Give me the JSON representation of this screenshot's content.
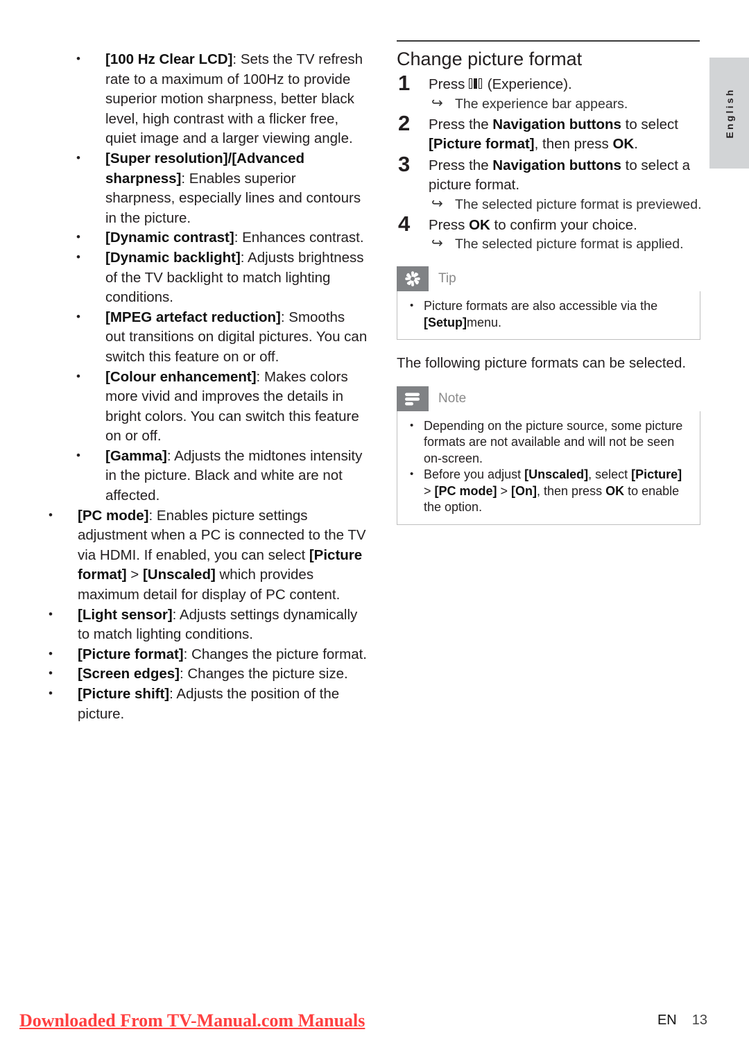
{
  "left_column": {
    "nested_bullets": [
      {
        "term": "[100 Hz Clear LCD]",
        "desc": ": Sets the TV refresh rate to a maximum of 100Hz to provide superior motion sharpness, better black level, high contrast with a flicker free, quiet image and a larger viewing angle."
      },
      {
        "term": "[Super resolution]/[Advanced sharpness]",
        "desc": ": Enables superior sharpness, especially lines and contours in the picture."
      },
      {
        "term": "[Dynamic contrast]",
        "desc": ": Enhances contrast."
      },
      {
        "term": "[Dynamic backlight]",
        "desc": ": Adjusts brightness of the TV backlight to match lighting conditions."
      },
      {
        "term": "[MPEG artefact reduction]",
        "desc": ": Smooths out transitions on digital pictures. You can switch this feature on or off."
      },
      {
        "term": "[Colour enhancement]",
        "desc": ": Makes colors more vivid and improves the details in bright colors. You can switch this feature on or off."
      },
      {
        "term": "[Gamma]",
        "desc": ": Adjusts the midtones intensity in the picture. Black and white are not affected."
      }
    ],
    "outer_bullets": [
      {
        "term": "[PC mode]",
        "desc_a": ": Enables picture settings adjustment when a PC is connected to the TV via HDMI. If enabled, you can select ",
        "emph_a": "[Picture format]",
        "desc_b": " > ",
        "emph_b": "[Unscaled]",
        "desc_c": " which provides maximum detail for display of PC content."
      },
      {
        "term": "[Light sensor]",
        "desc_a": ": Adjusts settings dynamically to match lighting conditions."
      },
      {
        "term": "[Picture format]",
        "desc_a": ": Changes the picture format."
      },
      {
        "term": "[Screen edges]",
        "desc_a": ": Changes the picture size."
      },
      {
        "term": "[Picture shift]",
        "desc_a": ": Adjusts the position of the picture."
      }
    ]
  },
  "right_column": {
    "heading": "Change picture format",
    "steps": [
      {
        "num": "1",
        "text_before_icon": "Press ",
        "icon": "experience-bars-icon",
        "text_after_icon": " (Experience).",
        "result": "The experience bar appears."
      },
      {
        "num": "2",
        "part1": "Press the ",
        "bold1": "Navigation buttons",
        "part2": " to select ",
        "bold2": "[Picture format]",
        "part3": ", then press ",
        "bold3": "OK",
        "part4": ".",
        "result": ""
      },
      {
        "num": "3",
        "part1": "Press the ",
        "bold1": "Navigation buttons",
        "part2": " to select a picture format.",
        "result": "The selected picture format is previewed."
      },
      {
        "num": "4",
        "part1": "Press ",
        "bold1": "OK",
        "part2": " to confirm your choice.",
        "result": "The selected picture format is applied."
      }
    ],
    "tip": {
      "label": "Tip",
      "icon": "asterisk-starburst-icon",
      "bullet_part1": "Picture formats are also accessible via the ",
      "bullet_bold": "[Setup]",
      "bullet_part2": "menu."
    },
    "paragraph": "The following picture formats can be selected.",
    "note": {
      "label": "Note",
      "icon": "note-lines-icon",
      "bullets": [
        {
          "part1": "Depending on the picture source, some picture formats are not available and will not be seen on-screen."
        },
        {
          "part1": "Before you adjust ",
          "bold1": "[Unscaled]",
          "part2": ", select ",
          "bold2": "[Picture]",
          "part3": " > ",
          "bold3": "[PC mode]",
          "part4": " > ",
          "bold4": "[On]",
          "part5": ", then press ",
          "bold5": "OK",
          "part6": " to enable the option."
        }
      ]
    }
  },
  "side_tab": {
    "label": "English"
  },
  "footer": {
    "watermark": "Downloaded From TV-Manual.com Manuals",
    "lang_code": "EN",
    "page_number": "13"
  },
  "colors": {
    "callout_icon_bg": "#808285",
    "callout_border": "#bfbfbf",
    "side_tab_bg": "#d2d4d6",
    "watermark": "#ff4040",
    "text": "#231f20"
  }
}
